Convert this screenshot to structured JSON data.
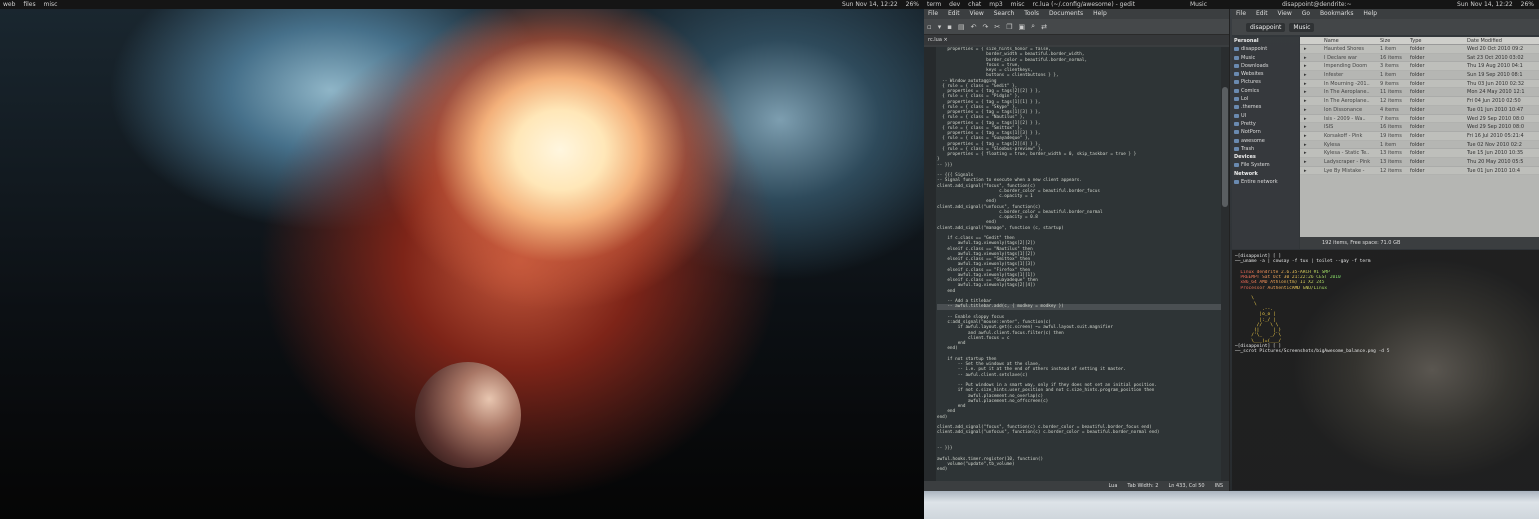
{
  "left_screen": {
    "tags": [
      "web",
      "files",
      "misc"
    ],
    "clock": "Sun Nov 14, 12:22",
    "battery": "26%"
  },
  "right_screen": {
    "tags": [
      "term",
      "dev",
      "chat",
      "mp3",
      "misc"
    ],
    "gedit_title": "rc.lua (~/.config/awesome) - gedit",
    "music_title": "Music",
    "nautilus_title": "disappoint@dendrite:~",
    "clock": "Sun Nov 14, 12:22",
    "battery": "26%"
  },
  "gedit": {
    "menu": [
      "File",
      "Edit",
      "View",
      "Search",
      "Tools",
      "Documents",
      "Help"
    ],
    "tab": "rc.lua",
    "code": [
      "    properties = { size_hints_honor = false,",
      "                   border_width = beautiful.border_width,",
      "                   border_color = beautiful.border_normal,",
      "                   focus = true,",
      "                   keys = clientkeys,",
      "                   buttons = clientbuttons } },",
      "  -- Window autotagging",
      "  { rule = { class = \"Gedit\" },",
      "    properties = { tag = tags[2][2] } },",
      "  { rule = { class = \"Pidgin\" },",
      "    properties = { tag = tags[1][1] } },",
      "  { rule = { class = \"Skype\" },",
      "    properties = { tag = tags[1][3] } },",
      "  { rule = { class = \"Nautilus\" },",
      "    properties = { tag = tags[1][2] } },",
      "  { rule = { class = \"Smittox\" },",
      "    properties = { tag = tags[1][3] } },",
      "  { rule = { class = \"Guayadeque\" },",
      "    properties = { tag = tags[2][4] } },",
      "  { rule = { class = \"Gloobus-preview\" },",
      "    properties = { floating = true, border_width = 0, skip_taskbar = true } }",
      "}",
      "-- }}}",
      "",
      "-- {{{ Signals",
      "-- Signal function to execute when a new client appears.",
      "client.add_signal(\"focus\", function(c)",
      "                        c.border_color = beautiful.border_focus",
      "                        c.opacity = 1",
      "                   end)",
      "client.add_signal(\"unfocus\", function(c)",
      "                        c.border_color = beautiful.border_normal",
      "                        c.opacity = 0.8",
      "                   end)",
      "client.add_signal(\"manage\", function (c, startup)",
      "",
      "    if c.class == \"Gedit\" then",
      "        awful.tag.viewonly(tags[2][2])",
      "    elseif c.class == \"Nautilus\" then",
      "        awful.tag.viewonly(tags[1][2])",
      "    elseif c.class == \"Smittox\" then",
      "        awful.tag.viewonly(tags[1][3])",
      "    elseif c.class == \"Firefox\" then",
      "        awful.tag.viewonly(tags[1][1])",
      "    elseif c.class == \"Guayadeque\" then",
      "        awful.tag.viewonly(tags[2][4])",
      "    end",
      "",
      "    -- Add a titlebar",
      "    -- awful.titlebar.add(c, { modkey = modkey })",
      "",
      "    -- Enable sloppy focus",
      "    c:add_signal(\"mouse::enter\", function(c)",
      "        if awful.layout.get(c.screen) ~= awful.layout.suit.magnifier",
      "            and awful.client.focus.filter(c) then",
      "            client.focus = c",
      "        end",
      "    end)",
      "",
      "    if not startup then",
      "        -- Set the windows at the slave,",
      "        -- i.e. put it at the end of others instead of setting it master.",
      "        -- awful.client.setslave(c)",
      "",
      "        -- Put windows in a smart way, only if they does not set an initial position.",
      "        if not c.size_hints.user_position and not c.size_hints.program_position then",
      "            awful.placement.no_overlap(c)",
      "            awful.placement.no_offscreen(c)",
      "        end",
      "    end",
      "end)",
      "",
      "client.add_signal(\"focus\", function(c) c.border_color = beautiful.border_focus end)",
      "client.add_signal(\"unfocus\", function(c) c.border_color = beautiful.border_normal end)",
      "",
      "",
      "-- }}}",
      "",
      "awful.hooks.timer.register(10, function()",
      "    volume(\"update\",tb_volume)",
      "end)"
    ],
    "highlight_line": 49,
    "status": {
      "language": "Lua",
      "tab_width": "Tab Width:  2",
      "position": "Ln 433, Col 50",
      "mode": "INS"
    }
  },
  "nautilus": {
    "menu": [
      "File",
      "Edit",
      "View",
      "Go",
      "Bookmarks",
      "Help"
    ],
    "path": [
      "disappoint",
      "Music"
    ],
    "sidebar": {
      "personal_header": "Personal",
      "personal": [
        "disappoint",
        "Music",
        "Downloads",
        "Websites",
        "Pictures",
        "Comics",
        "Lol",
        ".themes",
        "UI",
        "Pretty",
        "NotPorn",
        "awesome",
        "Trash"
      ],
      "devices_header": "Devices",
      "devices": [
        "File System"
      ],
      "network_header": "Network",
      "network": [
        "Entire network"
      ]
    },
    "columns": [
      "Name",
      "Size",
      "Type",
      "Date Modified"
    ],
    "rows": [
      {
        "name": "Haunted Shores",
        "size": "1 item",
        "type": "folder",
        "date": "Wed 20 Oct 2010 09:2"
      },
      {
        "name": "I Declare war",
        "size": "16 items",
        "type": "folder",
        "date": "Sat 23 Oct 2010 03:02"
      },
      {
        "name": "Impending Doom",
        "size": "3 items",
        "type": "folder",
        "date": "Thu 19 Aug 2010 04:1"
      },
      {
        "name": "Infester",
        "size": "1 item",
        "type": "folder",
        "date": "Sun 19 Sep 2010 08:1"
      },
      {
        "name": "In Mourning -201..",
        "size": "9 items",
        "type": "folder",
        "date": "Thu 03 Jun 2010 02:32"
      },
      {
        "name": "In The Aeroplane..",
        "size": "11 items",
        "type": "folder",
        "date": "Mon 24 May 2010 12:1"
      },
      {
        "name": "In The Aeroplane..",
        "size": "12 items",
        "type": "folder",
        "date": "Fri 04 Jun 2010 02:50"
      },
      {
        "name": "Ion Dissonance",
        "size": "4 items",
        "type": "folder",
        "date": "Tue 01 Jun 2010 10:47"
      },
      {
        "name": "Isis - 2009 - Wa..",
        "size": "7 items",
        "type": "folder",
        "date": "Wed 29 Sep 2010 08:0"
      },
      {
        "name": "ISIS",
        "size": "16 items",
        "type": "folder",
        "date": "Wed 29 Sep 2010 08:0"
      },
      {
        "name": "Korsakoff - Pink",
        "size": "19 items",
        "type": "folder",
        "date": "Fri 16 Jul 2010 05:21:4"
      },
      {
        "name": "Kylesa",
        "size": "1 item",
        "type": "folder",
        "date": "Tue 02 Nov 2010 02:2"
      },
      {
        "name": "Kylesa - Static Te..",
        "size": "13 items",
        "type": "folder",
        "date": "Tue 15 Jun 2010 10:35"
      },
      {
        "name": "Ladyscraper - Pink",
        "size": "13 items",
        "type": "folder",
        "date": "Thu 20 May 2010 05:5"
      },
      {
        "name": "Lye By Mistake -",
        "size": "12 items",
        "type": "folder",
        "date": "Tue 01 Jun 2010 10:4"
      }
    ],
    "status": "192 items, Free space: 71.0 GB"
  },
  "terminal": {
    "lines": [
      {
        "text": "─[disappoint] [ ]",
        "style": ""
      },
      {
        "text": "──‿uname -a | cowsay -f tux | toilet --gay -f term",
        "style": ""
      },
      {
        "text": "",
        "style": ""
      },
      {
        "text": "  Linux dendrite 2.6.35-ARCH #1 SMP",
        "style": "neon"
      },
      {
        "text": "  PREEMPT Sat Oct 30 21:22:26 CEST 2010",
        "style": "neon"
      },
      {
        "text": "  x86_64 AMD Athlon(tm) II X2 245",
        "style": "neon"
      },
      {
        "text": "  Processor AuthenticAMD GNU/Linux",
        "style": "neon"
      },
      {
        "text": "",
        "style": ""
      },
      {
        "text": "      \\",
        "style": "tux"
      },
      {
        "text": "       \\",
        "style": "tux"
      },
      {
        "text": "          .--.",
        "style": "tux"
      },
      {
        "text": "         |o_o |",
        "style": "tux"
      },
      {
        "text": "         |:_/ |",
        "style": "tux"
      },
      {
        "text": "        //   \\ \\",
        "style": "tux"
      },
      {
        "text": "       (|     | )",
        "style": "tux"
      },
      {
        "text": "      /'\\_   _/`\\",
        "style": "tux"
      },
      {
        "text": "      \\___)=(___/",
        "style": "tux"
      },
      {
        "text": "─[disappoint] [ ]",
        "style": ""
      },
      {
        "text": "──‿scrot Pictures/Screenshots/bigAwesome_balance.png -d 5",
        "style": ""
      }
    ]
  }
}
